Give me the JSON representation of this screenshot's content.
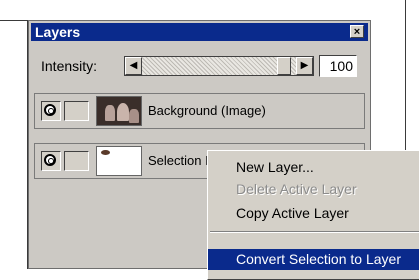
{
  "panel": {
    "title": "Layers",
    "close_glyph": "×",
    "intensity_label": "Intensity:",
    "intensity_value": "100",
    "slider_left_arrow": "◀",
    "slider_right_arrow": "▶"
  },
  "layers": [
    {
      "name": "Background (Image)",
      "thumbnail": "rocks-image"
    },
    {
      "name": "Selection I",
      "thumbnail": "selection-mask"
    }
  ],
  "context_menu": {
    "items": [
      {
        "label": "New Layer...",
        "state": "enabled"
      },
      {
        "label": "Delete Active Layer",
        "state": "disabled"
      },
      {
        "label": "Copy Active Layer",
        "state": "enabled"
      },
      {
        "label": "Convert Selection to Layer",
        "state": "selected"
      }
    ]
  },
  "colors": {
    "titlebar": "#0a2a8c",
    "panel_bg": "#ccc9c4",
    "menu_highlight": "#0a2a8c"
  }
}
